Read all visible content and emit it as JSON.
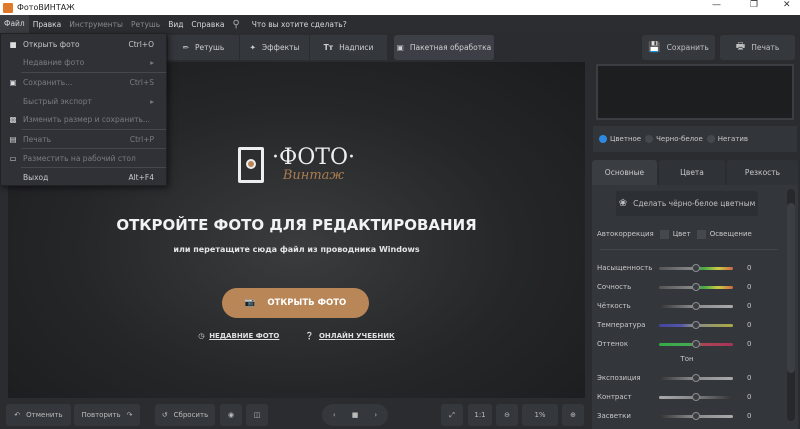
{
  "app": {
    "title": "ФотоВИНТАЖ"
  },
  "menubar": {
    "items": [
      "Файл",
      "Правка",
      "Инструменты",
      "Ретушь",
      "Вид",
      "Справка"
    ],
    "search_placeholder": "Что вы хотите сделать?"
  },
  "file_menu": [
    {
      "label": "Открыть фото",
      "shortcut": "Ctrl+O",
      "icon": "folder-icon"
    },
    {
      "label": "Недавние фото",
      "submenu": true
    },
    {
      "label": "Сохранить...",
      "shortcut": "Ctrl+S",
      "icon": "save-icon"
    },
    {
      "label": "Быстрый экспорт",
      "submenu": true
    },
    {
      "label": "Изменить размер и сохранить...",
      "icon": "resize-icon"
    },
    {
      "label": "Печать",
      "shortcut": "Ctrl+P",
      "icon": "print-icon"
    },
    {
      "label": "Разместить на рабочий стол",
      "icon": "monitor-icon"
    },
    {
      "label": "Выход",
      "shortcut": "Alt+F4"
    }
  ],
  "toolbar": {
    "tabs": [
      "Ретушь",
      "Эффекты",
      "Надписи",
      "Пакетная обработка"
    ],
    "save": "Сохранить",
    "print": "Печать"
  },
  "canvas": {
    "logo_top": "·ФОТО·",
    "logo_bottom": "Винтаж",
    "heading": "ОТКРОЙТЕ ФОТО ДЛЯ РЕДАКТИРОВАНИЯ",
    "subtitle": "или перетащите сюда файл из проводника Windows",
    "open_button": "ОТКРЫТЬ ФОТО",
    "recent": "НЕДАВНИЕ ФОТО",
    "tutorial": "ОНЛАЙН УЧЕБНИК"
  },
  "right_panel": {
    "modes": [
      "Цветное",
      "Черно-белое",
      "Негатив"
    ],
    "selected_mode": "Цветное",
    "tabs": [
      "Основные",
      "Цвета",
      "Резкость"
    ],
    "colorize_button": "Сделать чёрно-белое цветным",
    "autocorrection": {
      "label": "Автокоррекция",
      "color": "Цвет",
      "light": "Освещение"
    },
    "sliders": [
      {
        "name": "Насыщенность",
        "value": "0"
      },
      {
        "name": "Сочность",
        "value": "0"
      },
      {
        "name": "Чёткость",
        "value": "0"
      },
      {
        "name": "Температура",
        "value": "0"
      },
      {
        "name": "Оттенок",
        "value": "0"
      }
    ],
    "tone_header": "Тон",
    "tone_sliders": [
      {
        "name": "Экспозиция",
        "value": "0"
      },
      {
        "name": "Контраст",
        "value": "0"
      },
      {
        "name": "Засветки",
        "value": "0"
      }
    ]
  },
  "bottom": {
    "undo": "Отменить",
    "redo": "Повторить",
    "reset": "Сбросить",
    "one_to_one": "1:1",
    "zoom": "1%"
  },
  "colors": {
    "accent": "#b98757",
    "radio": "#2d8ae0"
  }
}
